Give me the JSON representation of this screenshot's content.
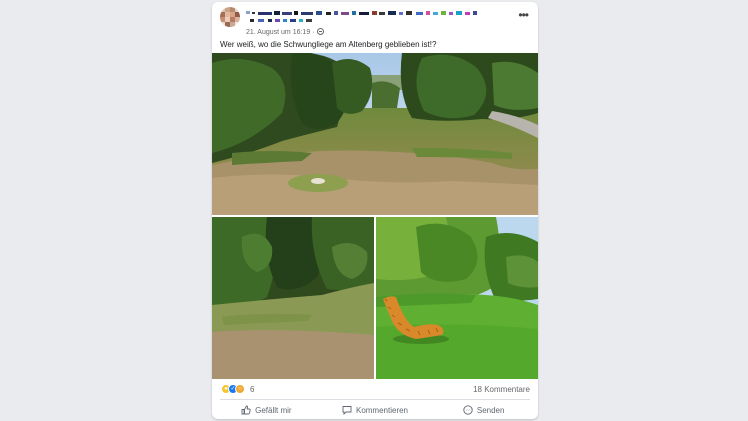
{
  "post": {
    "date": "21. August um 16:19 ·",
    "caption": "Wer weiß, wo die Schwungliege am Altenberg geblieben ist!?",
    "author_obscured": true,
    "more_icon": "more-dots-icon",
    "privacy_icon": "globe-icon"
  },
  "reactions": {
    "types": [
      "haha",
      "like",
      "wow"
    ],
    "count": "6",
    "comments": "18 Kommentare"
  },
  "actions": {
    "like": "Gefällt mir",
    "comment": "Kommentieren",
    "send": "Senden"
  },
  "colors": {
    "accent": "#1877f2",
    "secondary_text": "#65676b"
  }
}
